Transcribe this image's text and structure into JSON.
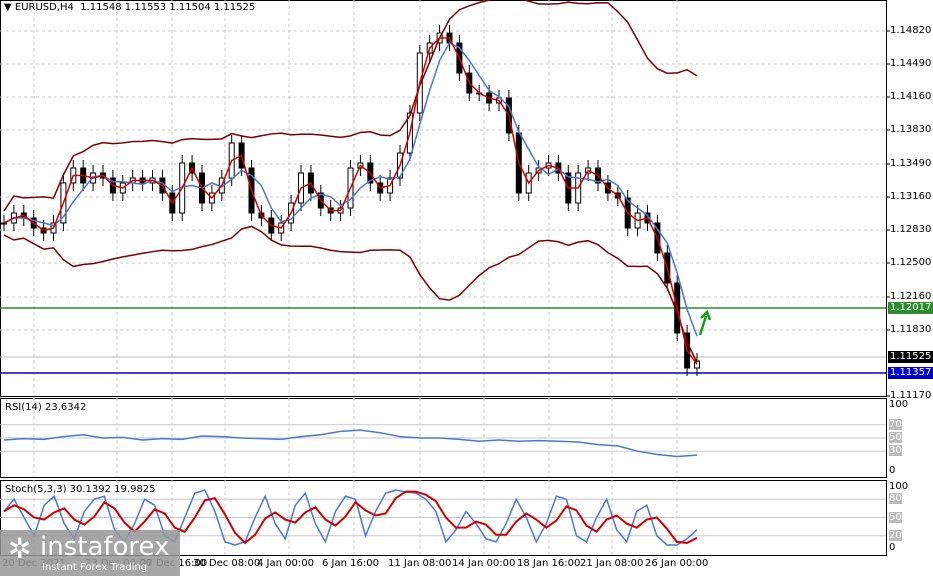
{
  "header": {
    "symbol": "EURUSD,H4",
    "ohlc": "1.11548 1.11553 1.11504 1.11525"
  },
  "price_axis": [
    "1.14820",
    "1.14490",
    "1.14160",
    "1.13830",
    "1.13490",
    "1.13160",
    "1.12830",
    "1.12500",
    "1.12160",
    "1.11830",
    "1.11170"
  ],
  "price_tags": {
    "resistance": "1.12017",
    "current": "1.11525",
    "support": "1.11357"
  },
  "colors": {
    "resistance": "#2e8b2e",
    "support": "#0000cc",
    "current": "#000000",
    "ma_fast": "#d00000",
    "ma_slow": "#4a78d0",
    "bands": "#7a0000"
  },
  "rsi": {
    "label": "RSI(14) 23.6342",
    "levels": [
      "100",
      "70",
      "50",
      "30",
      "0"
    ]
  },
  "stoch": {
    "label": "Stoch(5,3,3) 30.1392 19.9825",
    "levels": [
      "100",
      "80",
      "50",
      "20",
      "0"
    ]
  },
  "time_axis": [
    "20 Dec 2021",
    "23 Dec 00:00",
    "27 Dec 16:00",
    "30 Dec 08:00",
    "4 Jan 00:00",
    "6 Jan 16:00",
    "11 Jan 08:00",
    "14 Jan 00:00",
    "18 Jan 16:00",
    "21 Jan 08:00",
    "26 Jan 00:00"
  ],
  "logo": {
    "name": "instaforex",
    "tagline": "Instant Forex Trading"
  },
  "chart_data": {
    "type": "line",
    "title": "EURUSD,H4",
    "closes": [
      1.129,
      1.13,
      1.1295,
      1.1285,
      1.128,
      1.129,
      1.133,
      1.1345,
      1.133,
      1.134,
      1.1335,
      1.132,
      1.133,
      1.1335,
      1.133,
      1.1335,
      1.132,
      1.13,
      1.135,
      1.134,
      1.131,
      1.132,
      1.1335,
      1.137,
      1.1345,
      1.13,
      1.1295,
      1.128,
      1.129,
      1.131,
      1.134,
      1.132,
      1.1305,
      1.13,
      1.1305,
      1.1345,
      1.135,
      1.133,
      1.132,
      1.1335,
      1.136,
      1.14,
      1.146,
      1.147,
      1.148,
      1.147,
      1.144,
      1.142,
      1.142,
      1.141,
      1.1415,
      1.138,
      1.132,
      1.134,
      1.1345,
      1.135,
      1.134,
      1.131,
      1.134,
      1.1345,
      1.133,
      1.132,
      1.1315,
      1.1285,
      1.13,
      1.129,
      1.126,
      1.123,
      1.118,
      1.1145,
      1.1152
    ],
    "ylim": [
      1.1117,
      1.1513
    ],
    "rsi": [
      47,
      49,
      48,
      52,
      55,
      50,
      51,
      47,
      49,
      48,
      53,
      52,
      50,
      49,
      48,
      52,
      55,
      60,
      62,
      58,
      52,
      50,
      50,
      48,
      45,
      47,
      45,
      46,
      45,
      44,
      40,
      38,
      30,
      25,
      22,
      24
    ],
    "stoch_k": [
      60,
      80,
      50,
      20,
      70,
      85,
      40,
      15,
      60,
      80,
      85,
      30,
      10,
      40,
      80,
      70,
      20,
      10,
      50,
      90,
      95,
      60,
      10,
      5,
      10,
      50,
      85,
      40,
      15,
      70,
      90,
      40,
      10,
      60,
      85,
      80,
      20,
      60,
      90,
      95,
      92,
      90,
      80,
      60,
      10,
      30,
      60,
      40,
      15,
      10,
      40,
      80,
      50,
      10,
      40,
      85,
      80,
      20,
      10,
      50,
      80,
      30,
      10,
      60,
      70,
      20,
      5,
      5,
      15,
      30
    ]
  }
}
